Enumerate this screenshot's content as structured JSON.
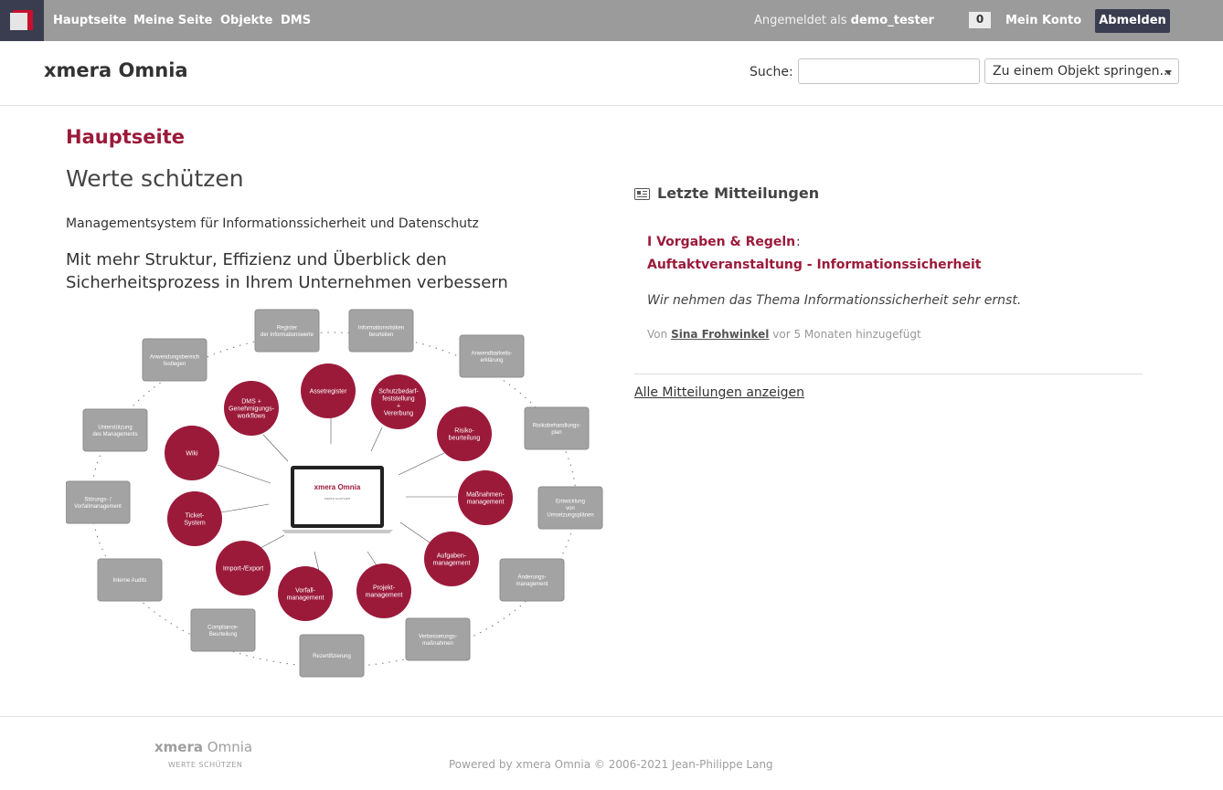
{
  "top_menu": {
    "items": [
      "Hauptseite",
      "Meine Seite",
      "Objekte",
      "DMS"
    ],
    "logged_in_prefix": "Angemeldet als",
    "username": "demo_tester",
    "notification_count": "0",
    "my_account": "Mein Konto",
    "logout": "Abmelden"
  },
  "header": {
    "title": "xmera Omnia",
    "search_label": "Suche:",
    "search_value": "",
    "jump_placeholder": "Zu einem Objekt springen..."
  },
  "page": {
    "heading": "Hauptseite",
    "tagline_title": "Werte schützen",
    "tagline_sub": "Managementsystem für Informationssicherheit und Datenschutz",
    "tagline_lead": "Mit mehr Struktur, Effizienz und Überblick den Sicherheitsprozess in Ihrem Unternehmen verbessern"
  },
  "diagram": {
    "center_title": "xmera Omnia",
    "center_subtitle": "WERTE SCHÜTZEN",
    "outer_boxes": [
      [
        "Register",
        "der Informationswerte"
      ],
      [
        "Informationsrisiken",
        "beurteilen"
      ],
      [
        "Anwendbarkeits-",
        "erklärung"
      ],
      [
        "Risikobehandlungs-",
        "plan"
      ],
      [
        "Entwicklung",
        "von",
        "Umsetzungsplänen"
      ],
      [
        "Änderungs-",
        "management"
      ],
      [
        "Verbesserungs-",
        "maßnahmen"
      ],
      [
        "Rezertifizierung"
      ],
      [
        "Compliance-",
        "Beurteilung"
      ],
      [
        "Interne Audits"
      ],
      [
        "Störungs- /",
        "Vorfallmanagement"
      ],
      [
        "Unterstützung",
        "des Managements"
      ],
      [
        "Anwendungsbereich",
        "festlegen"
      ]
    ],
    "inner_circles": [
      [
        "Assetregister"
      ],
      [
        "Schutzbedarf-",
        "feststellung",
        "+",
        "Vererbung"
      ],
      [
        "Risiko-",
        "beurteilung"
      ],
      [
        "Maßnahmen-",
        "management"
      ],
      [
        "Aufgaben-",
        "management"
      ],
      [
        "Projekt-",
        "management"
      ],
      [
        "Vorfall-",
        "management"
      ],
      [
        "Import-/Export"
      ],
      [
        "Ticket-",
        "System"
      ],
      [
        "Wiki"
      ],
      [
        "DMS +",
        "Genehmigungs-",
        "workflows"
      ]
    ]
  },
  "news": {
    "heading": "Letzte Mitteilungen",
    "project": "I Vorgaben & Regeln",
    "colon": ":",
    "title": "Auftaktveranstaltung - Informationssicherheit",
    "summary": "Wir nehmen das Thema Informationssicherheit sehr ernst.",
    "by": "Von",
    "author": "Sina Frohwinkel",
    "added": "vor 5 Monaten hinzugefügt",
    "all_link": "Alle Mitteilungen anzeigen"
  },
  "footer": {
    "logo_bold": "xmera",
    "logo_light": "Omnia",
    "slogan": "WERTE SCHÜTZEN",
    "powered": "Powered by xmera Omnia © 2006-2021 Jean-Philippe Lang"
  },
  "colors": {
    "accent": "#9b1a3a",
    "topbar": "#9b9b9b",
    "dark": "#3a3d4f"
  }
}
